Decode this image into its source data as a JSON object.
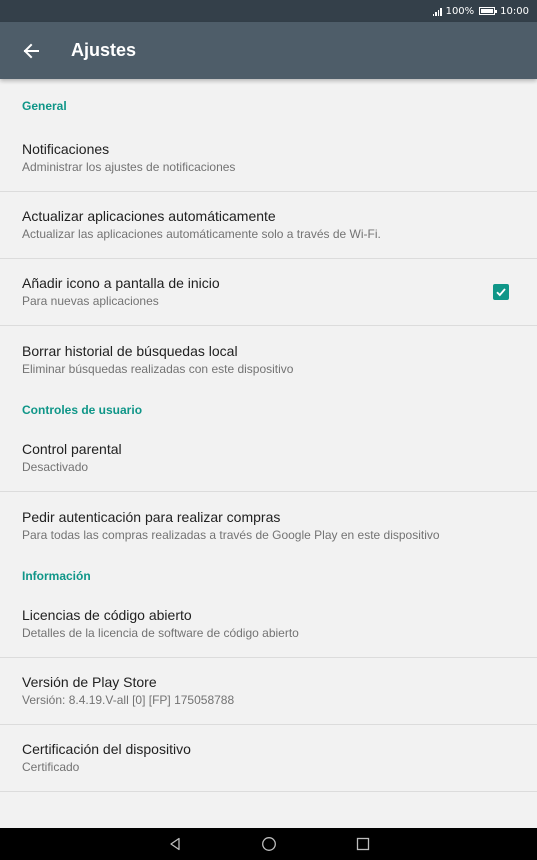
{
  "status_bar": {
    "battery_percent": "100%",
    "time": "10:00"
  },
  "app_bar": {
    "title": "Ajustes"
  },
  "colors": {
    "accent": "#0f9688",
    "app_bar": "#4e5d69",
    "status_bar": "#34404a"
  },
  "sections": [
    {
      "header": "General",
      "items": [
        {
          "title": "Notificaciones",
          "summary": "Administrar los ajustes de notificaciones"
        },
        {
          "title": "Actualizar aplicaciones automáticamente",
          "summary": "Actualizar las aplicaciones automáticamente solo a través de Wi-Fi."
        },
        {
          "title": "Añadir icono a pantalla de inicio",
          "summary": "Para nuevas aplicaciones",
          "checked": true
        },
        {
          "title": "Borrar historial de búsquedas  local",
          "summary": "Eliminar búsquedas realizadas con este dispositivo"
        }
      ]
    },
    {
      "header": "Controles de usuario",
      "items": [
        {
          "title": "Control parental",
          "summary": "Desactivado"
        },
        {
          "title": "Pedir autenticación para realizar compras",
          "summary": "Para todas las compras realizadas a través de Google Play en este dispositivo"
        }
      ]
    },
    {
      "header": "Información",
      "items": [
        {
          "title": "Licencias de código abierto",
          "summary": "Detalles de la licencia de software de código abierto"
        },
        {
          "title": "Versión de Play Store",
          "summary": "Versión: 8.4.19.V-all [0] [FP] 175058788"
        },
        {
          "title": "Certificación del dispositivo",
          "summary": "Certificado"
        }
      ]
    }
  ],
  "nav_bar": {
    "icons": [
      "back-triangle-icon",
      "home-circle-icon",
      "recents-square-icon"
    ]
  }
}
